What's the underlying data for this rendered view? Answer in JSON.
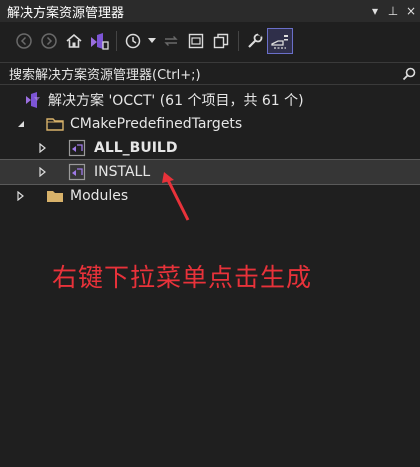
{
  "window": {
    "title": "解决方案资源管理器",
    "pin_glyph": "▾",
    "pin2_glyph": "⊥",
    "close_glyph": "×"
  },
  "toolbar": {
    "buttons": [
      "back-icon",
      "forward-icon",
      "home-icon",
      "vs-solution-icon",
      "history-icon",
      "dropdown-icon",
      "sync-icon",
      "collapse-all-icon",
      "copy-icon",
      "properties-wrench-icon",
      "preview-icon"
    ]
  },
  "search": {
    "placeholder": "搜索解决方案资源管理器(Ctrl+;)"
  },
  "tree": {
    "solution": "解决方案 'OCCT' (61 个项目，共 61 个)",
    "folder1": "CMakePredefinedTargets",
    "item_all_build": "ALL_BUILD",
    "item_install": "INSTALL",
    "folder2": "Modules"
  },
  "annotation": {
    "text": "右键下拉菜单点击生成",
    "color": "#e8323a"
  },
  "colors": {
    "background": "#1f1f1f",
    "selection": "#363636",
    "accent": "#6a6fc9",
    "folder": "#d8b26a"
  }
}
